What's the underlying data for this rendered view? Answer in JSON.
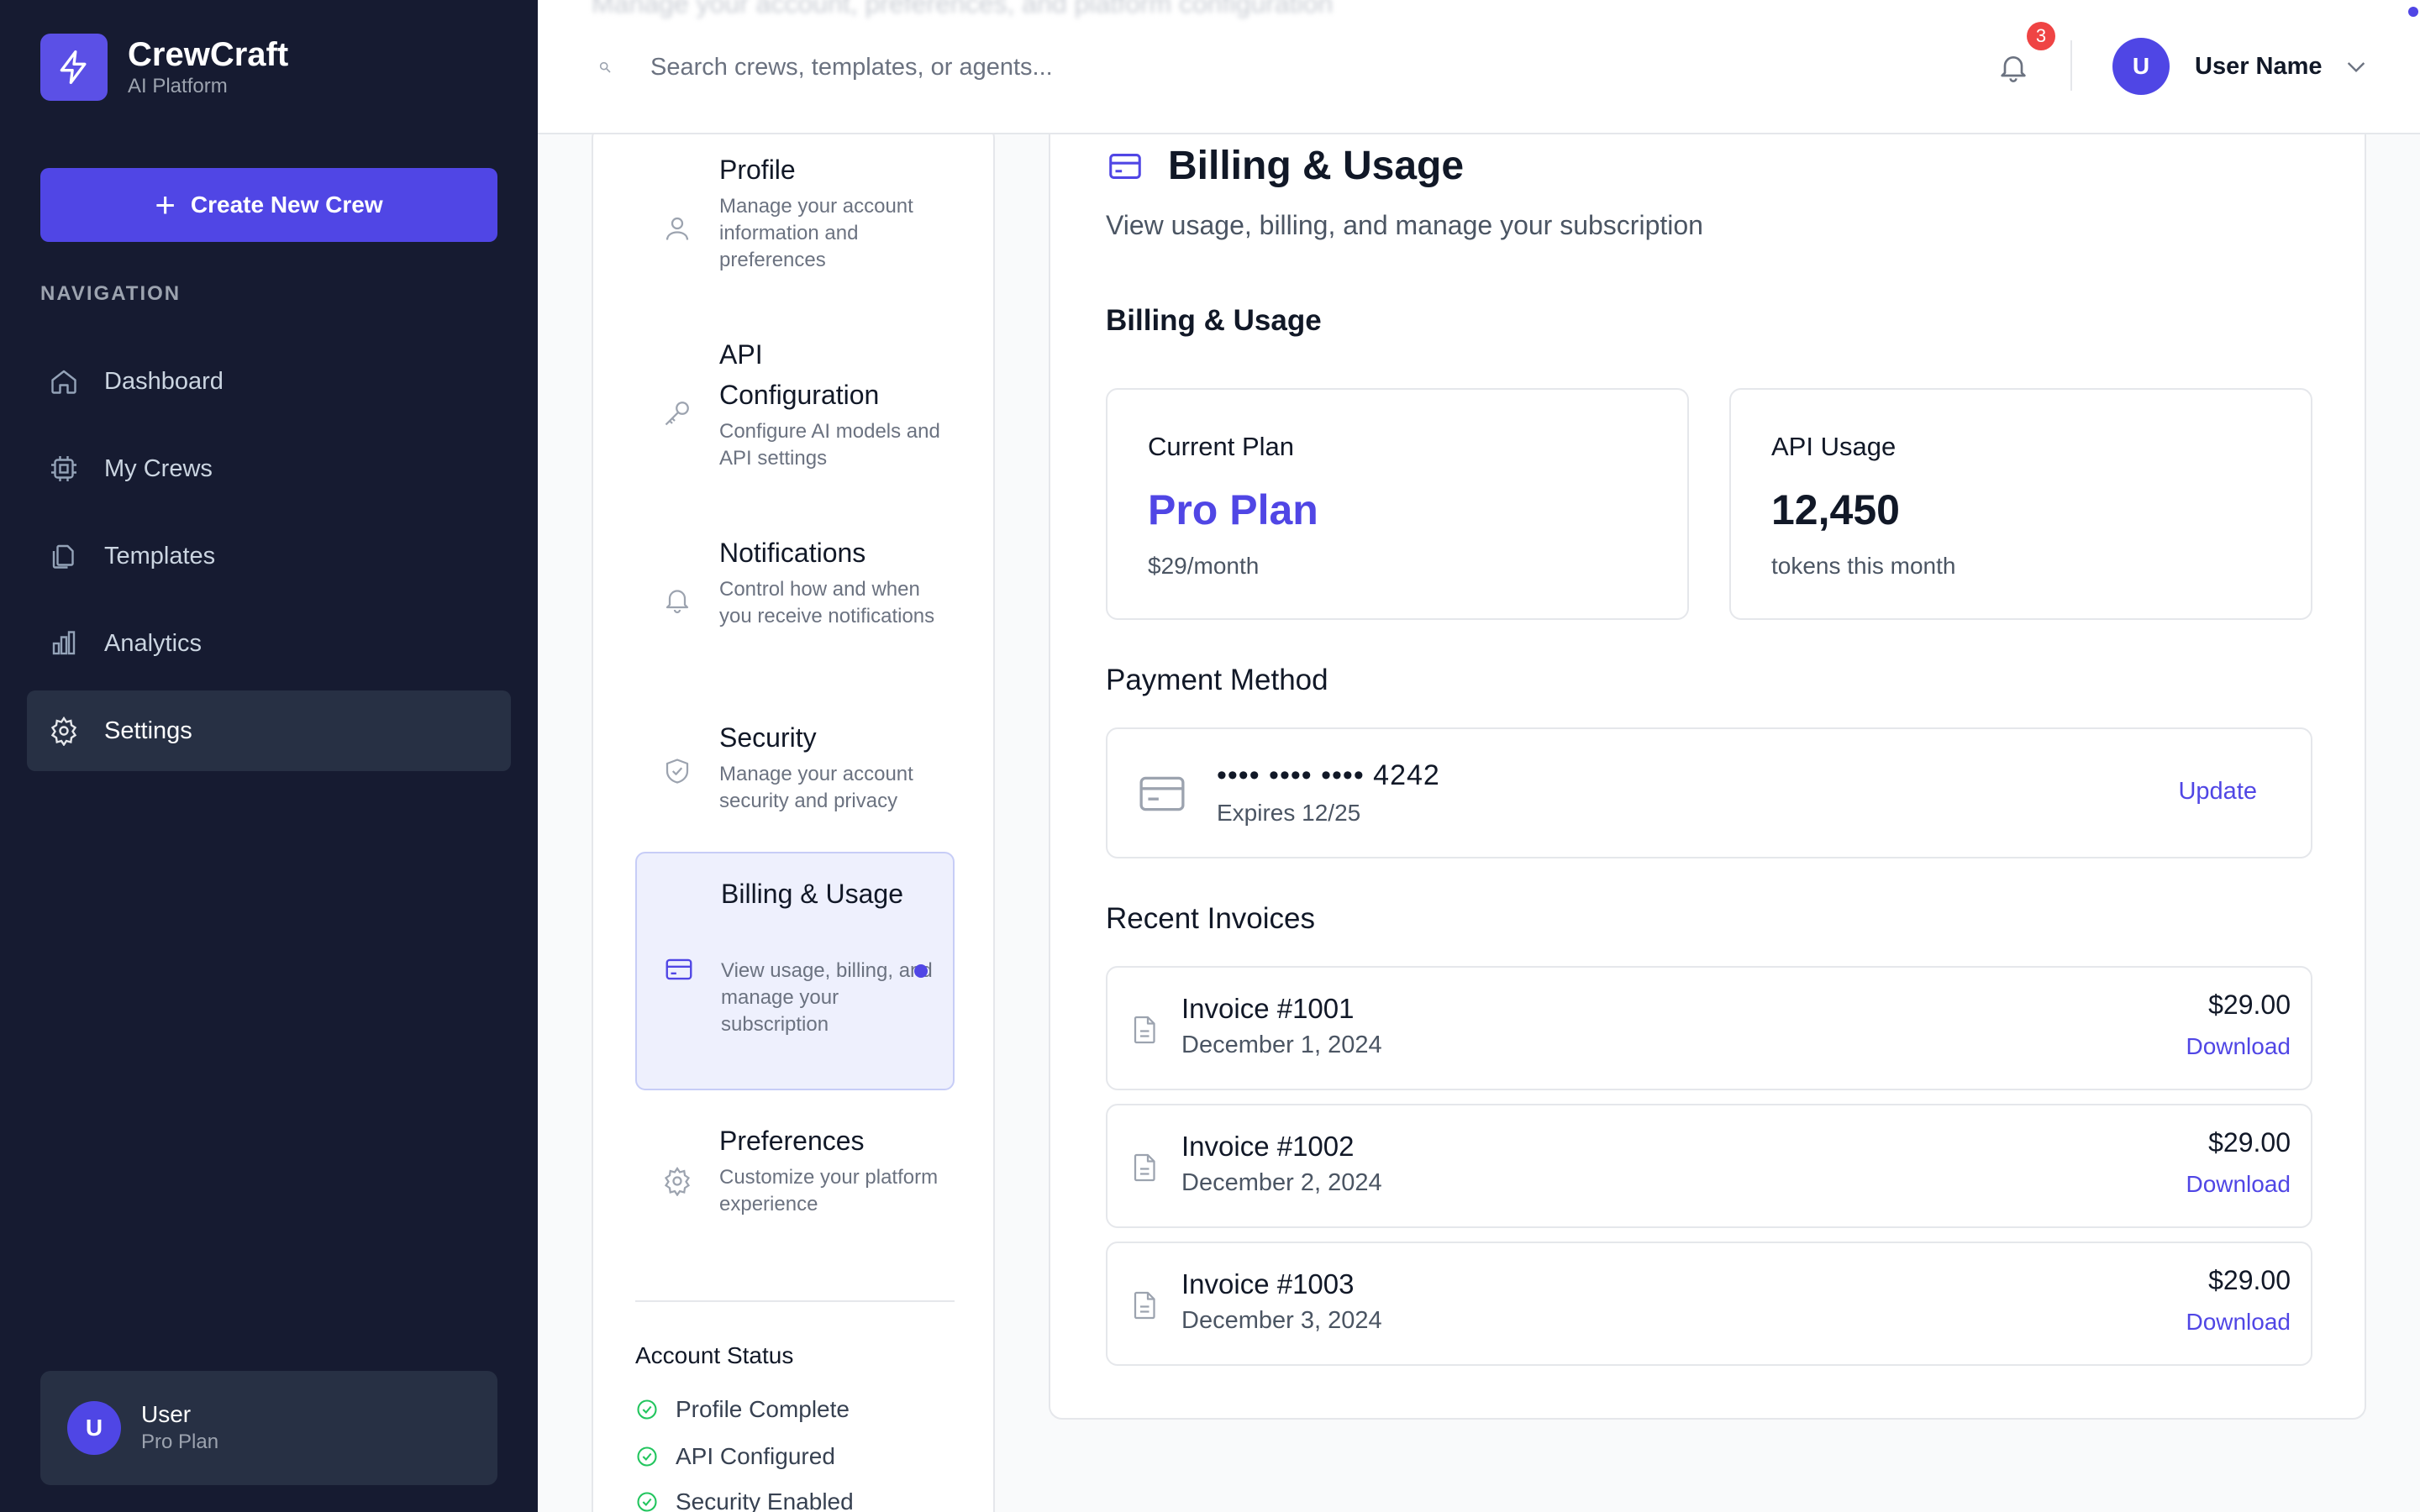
{
  "app": {
    "name": "CrewCraft",
    "subtitle": "AI Platform"
  },
  "sidebar": {
    "create_button": "Create New Crew",
    "nav_heading": "NAVIGATION",
    "items": [
      {
        "label": "Dashboard",
        "icon": "home-icon"
      },
      {
        "label": "My Crews",
        "icon": "cpu-icon"
      },
      {
        "label": "Templates",
        "icon": "copy-icon"
      },
      {
        "label": "Analytics",
        "icon": "bar-chart-icon"
      },
      {
        "label": "Settings",
        "icon": "gear-icon",
        "active": true
      }
    ],
    "user": {
      "initial": "U",
      "name": "User",
      "plan": "Pro Plan"
    }
  },
  "header": {
    "ghost_subtitle": "Manage your account, preferences, and platform configuration",
    "search_placeholder": "Search crews, templates, or agents...",
    "notification_count": "3",
    "user_initial": "U",
    "user_name": "User Name"
  },
  "settings_nav": {
    "items": [
      {
        "title": "Profile",
        "description": "Manage your account information and preferences",
        "icon": "user-icon"
      },
      {
        "title": "API Configuration",
        "description": "Configure AI models and API settings",
        "icon": "key-icon"
      },
      {
        "title": "Notifications",
        "description": "Control how and when you receive notifications",
        "icon": "bell-icon"
      },
      {
        "title": "Security",
        "description": "Manage your account security and privacy",
        "icon": "shield-check-icon"
      },
      {
        "title": "Billing & Usage",
        "description": "View usage, billing, and manage your subscription",
        "icon": "credit-card-icon",
        "active": true
      },
      {
        "title": "Preferences",
        "description": "Customize your platform experience",
        "icon": "gear-icon"
      }
    ],
    "status_heading": "Account Status",
    "status_items": [
      "Profile Complete",
      "API Configured",
      "Security Enabled"
    ]
  },
  "main": {
    "title": "Billing & Usage",
    "subtitle": "View usage, billing, and manage your subscription",
    "section_title": "Billing & Usage",
    "current_plan": {
      "label": "Current Plan",
      "value": "Pro Plan",
      "note": "$29/month"
    },
    "api_usage": {
      "label": "API Usage",
      "value": "12,450",
      "note": "tokens this month"
    },
    "payment": {
      "heading": "Payment Method",
      "card_number": "•••• •••• •••• 4242",
      "expires": "Expires 12/25",
      "update_label": "Update"
    },
    "invoices_heading": "Recent Invoices",
    "invoices": [
      {
        "title": "Invoice #1001",
        "date": "December 1, 2024",
        "amount": "$29.00",
        "action": "Download"
      },
      {
        "title": "Invoice #1002",
        "date": "December 2, 2024",
        "amount": "$29.00",
        "action": "Download"
      },
      {
        "title": "Invoice #1003",
        "date": "December 3, 2024",
        "amount": "$29.00",
        "action": "Download"
      }
    ]
  },
  "colors": {
    "sidebar_bg": "#161b31",
    "accent": "#5046e5",
    "active_nav_bg": "#273044",
    "badge": "#ef4444",
    "success": "#22c55e"
  }
}
